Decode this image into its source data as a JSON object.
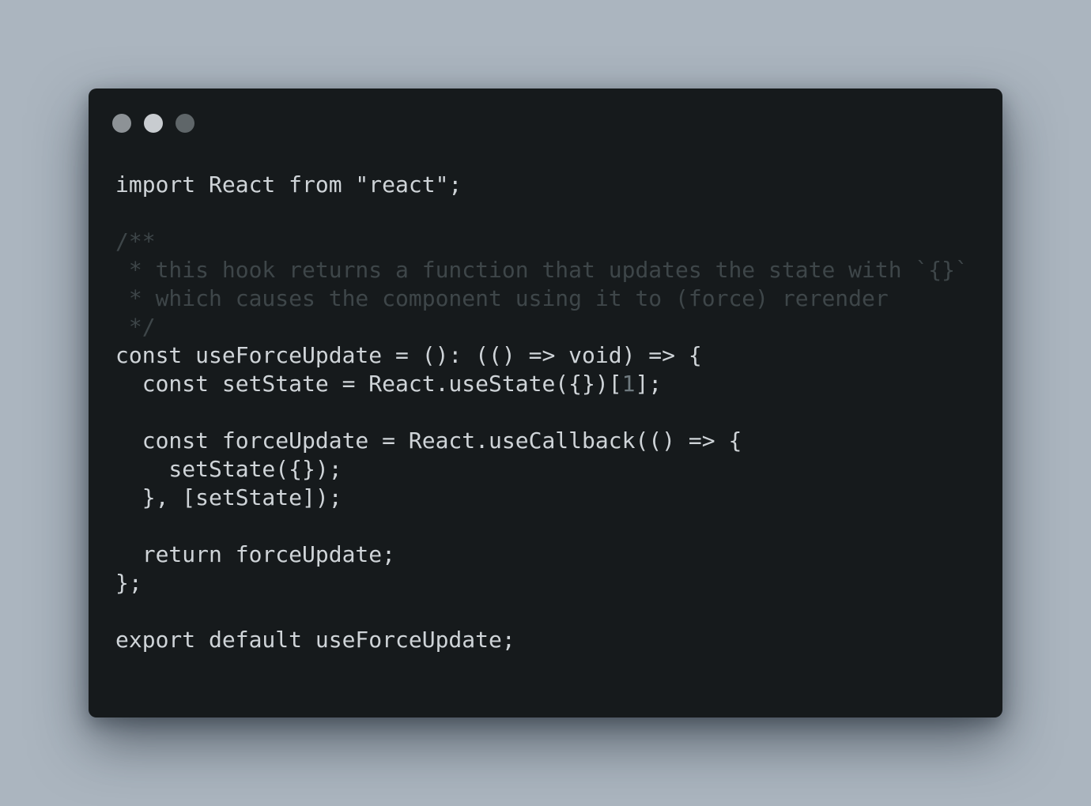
{
  "window": {
    "controls": [
      "close-icon",
      "minimize-icon",
      "maximize-icon"
    ]
  },
  "code": {
    "lines": [
      {
        "segments": [
          {
            "text": "import React from \"react\";",
            "kind": "plain"
          }
        ]
      },
      {
        "segments": [
          {
            "text": "",
            "kind": "plain"
          }
        ]
      },
      {
        "segments": [
          {
            "text": "/**",
            "kind": "comment"
          }
        ]
      },
      {
        "segments": [
          {
            "text": " * this hook returns a function that updates the state with `{}`",
            "kind": "comment"
          }
        ]
      },
      {
        "segments": [
          {
            "text": " * which causes the component using it to (force) rerender",
            "kind": "comment"
          }
        ]
      },
      {
        "segments": [
          {
            "text": " */",
            "kind": "comment"
          }
        ]
      },
      {
        "segments": [
          {
            "text": "const useForceUpdate = (): (() => void) => {",
            "kind": "plain"
          }
        ]
      },
      {
        "segments": [
          {
            "text": "  const setState = React.useState({})[",
            "kind": "plain"
          },
          {
            "text": "1",
            "kind": "number"
          },
          {
            "text": "];",
            "kind": "plain"
          }
        ]
      },
      {
        "segments": [
          {
            "text": "",
            "kind": "plain"
          }
        ]
      },
      {
        "segments": [
          {
            "text": "  const forceUpdate = React.useCallback(() => {",
            "kind": "plain"
          }
        ]
      },
      {
        "segments": [
          {
            "text": "    setState({});",
            "kind": "plain"
          }
        ]
      },
      {
        "segments": [
          {
            "text": "  }, [setState]);",
            "kind": "plain"
          }
        ]
      },
      {
        "segments": [
          {
            "text": "",
            "kind": "plain"
          }
        ]
      },
      {
        "segments": [
          {
            "text": "  return forceUpdate;",
            "kind": "plain"
          }
        ]
      },
      {
        "segments": [
          {
            "text": "};",
            "kind": "plain"
          }
        ]
      },
      {
        "segments": [
          {
            "text": "",
            "kind": "plain"
          }
        ]
      },
      {
        "segments": [
          {
            "text": "export default useForceUpdate;",
            "kind": "plain"
          }
        ]
      }
    ]
  },
  "colors": {
    "background": "#abb5bf",
    "window": "#161a1c",
    "text": "#cfd4d8",
    "comment": "#3e4649",
    "number": "#6f7a7f"
  }
}
